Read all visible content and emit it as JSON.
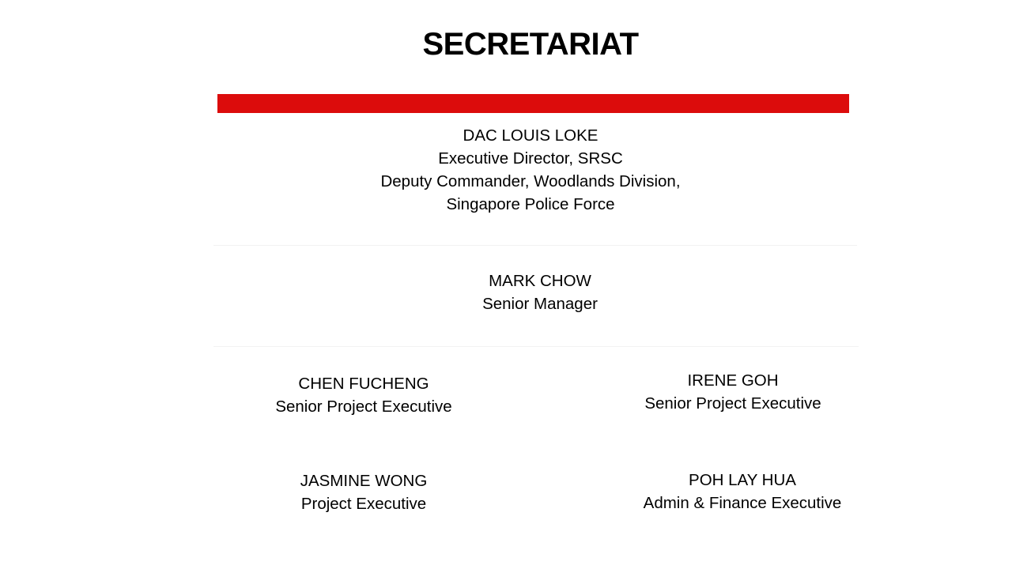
{
  "slide": {
    "title": "SECRETARIAT",
    "accent_color": "#dc0c0c"
  },
  "director": {
    "name": "DAC LOUIS  LOKE",
    "line1": "Executive Director, SRSC",
    "line2": "Deputy Commander, Woodlands Division,",
    "line3": "Singapore Police Force"
  },
  "manager": {
    "name": "MARK CHOW",
    "role": "Senior Manager"
  },
  "staff": [
    {
      "name": "CHEN FUCHENG",
      "role": "Senior Project Executive"
    },
    {
      "name": "IRENE GOH",
      "role": "Senior Project Executive"
    },
    {
      "name": "JASMINE WONG",
      "role": "Project Executive"
    },
    {
      "name": "POH LAY HUA",
      "role": "Admin & Finance Executive"
    }
  ]
}
